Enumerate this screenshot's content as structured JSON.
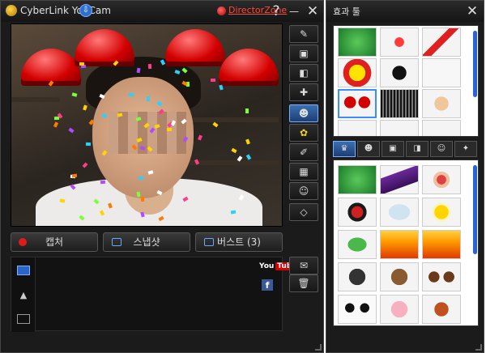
{
  "app": {
    "title": "CyberLink YouCam",
    "director_zone": "DirectorZone"
  },
  "title_buttons": {
    "help": "?",
    "minimize": "—",
    "close": "✕"
  },
  "capture": {
    "capture_label": "캡처",
    "snapshot_label": "스냅샷",
    "burst_label": "버스트 (3)"
  },
  "social": {
    "youtube_you": "You",
    "youtube_tube": "Tube",
    "facebook": "f"
  },
  "effects": {
    "title": "효과 툴",
    "close": "✕"
  },
  "colors": {
    "accent": "#2a62d8",
    "titlebar_link": "#ff4a3a",
    "window_bg": "#1b1b1b"
  },
  "icons": {
    "tools": [
      "tools-icon",
      "frame-icon",
      "camera-settings-icon",
      "add-effect-icon"
    ],
    "modes": [
      "avatar-effect-icon",
      "particle-icon",
      "brush-icon",
      "scene-icon",
      "face-track-icon"
    ],
    "gallery": [
      "photo-mode-icon",
      "avatar-mode-icon",
      "video-mode-icon"
    ],
    "effect_tabs": [
      "avatar-hat-icon",
      "avatar-face-icon",
      "frame-tab-icon",
      "overlay-tab-icon",
      "emotion-tab-icon",
      "magic-tab-icon"
    ]
  }
}
